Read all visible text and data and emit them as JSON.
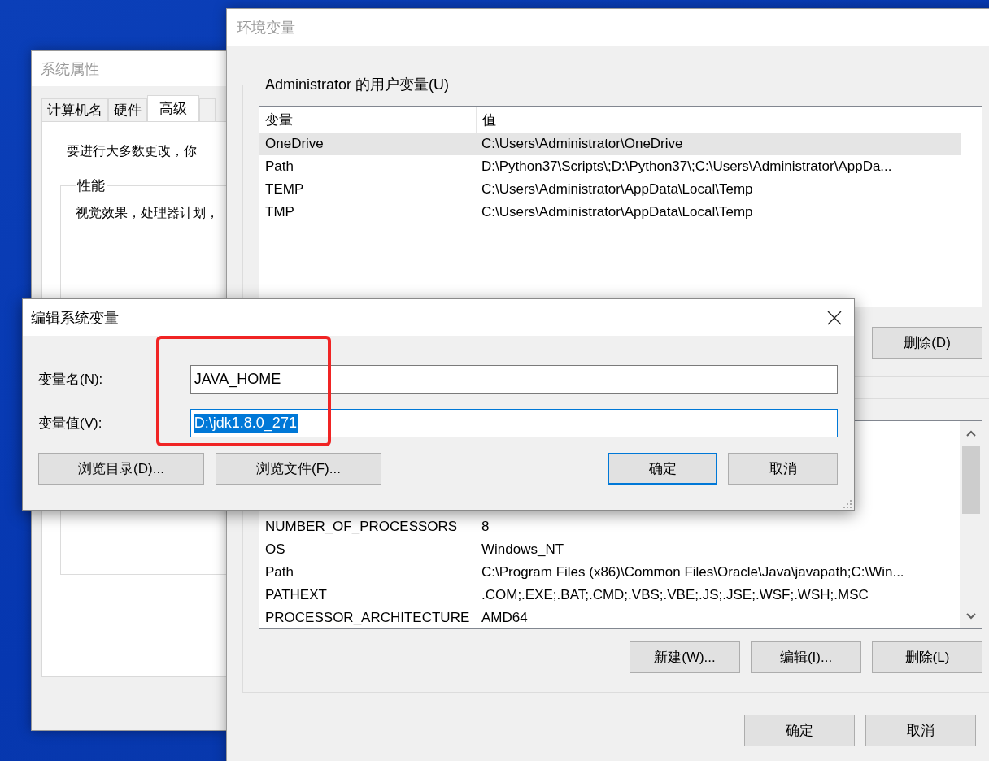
{
  "system_properties": {
    "title": "系统属性",
    "active": false,
    "tabs": [
      {
        "label": "计算机名",
        "selected": false
      },
      {
        "label": "硬件",
        "selected": false
      },
      {
        "label": "高级",
        "selected": true
      }
    ],
    "intro_text": "要进行大多数更改，你",
    "performance": {
      "label": "性能",
      "text": "视觉效果，处理器计划，"
    }
  },
  "environment_variables": {
    "title": "环境变量",
    "active": false,
    "user_variables": {
      "label": "Administrator 的用户变量(U)",
      "columns": [
        "变量",
        "值"
      ],
      "rows": [
        {
          "name": "OneDrive",
          "value": "C:\\Users\\Administrator\\OneDrive",
          "selected": true
        },
        {
          "name": "Path",
          "value": "D:\\Python37\\Scripts\\;D:\\Python37\\;C:\\Users\\Administrator\\AppDa...",
          "selected": false
        },
        {
          "name": "TEMP",
          "value": "C:\\Users\\Administrator\\AppData\\Local\\Temp",
          "selected": false
        },
        {
          "name": "TMP",
          "value": "C:\\Users\\Administrator\\AppData\\Local\\Temp",
          "selected": false
        }
      ],
      "buttons": [
        "删除(D)"
      ]
    },
    "system_variables": {
      "rows": [
        {
          "name": "NUMBER_OF_PROCESSORS",
          "value": "8",
          "selected": false
        },
        {
          "name": "OS",
          "value": "Windows_NT",
          "selected": false
        },
        {
          "name": "Path",
          "value": "C:\\Program Files (x86)\\Common Files\\Oracle\\Java\\javapath;C:\\Win...",
          "selected": false
        },
        {
          "name": "PATHEXT",
          "value": ".COM;.EXE;.BAT;.CMD;.VBS;.VBE;.JS;.JSE;.WSF;.WSH;.MSC",
          "selected": false
        },
        {
          "name": "PROCESSOR_ARCHITECTURE",
          "value": "AMD64",
          "selected": false
        }
      ],
      "buttons": [
        "新建(W)...",
        "编辑(I)...",
        "删除(L)"
      ]
    },
    "buttons": [
      "确定",
      "取消"
    ]
  },
  "edit_dialog": {
    "title": "编辑系统变量",
    "active": true,
    "fields": [
      {
        "label": "变量名(N):",
        "value": "JAVA_HOME",
        "focused": false
      },
      {
        "label": "变量值(V):",
        "value": "D:\\jdk1.8.0_271",
        "focused": true
      }
    ],
    "browse_buttons": [
      "浏览目录(D)...",
      "浏览文件(F)..."
    ],
    "buttons": [
      {
        "label": "确定",
        "default": true
      },
      {
        "label": "取消",
        "default": false
      }
    ]
  }
}
